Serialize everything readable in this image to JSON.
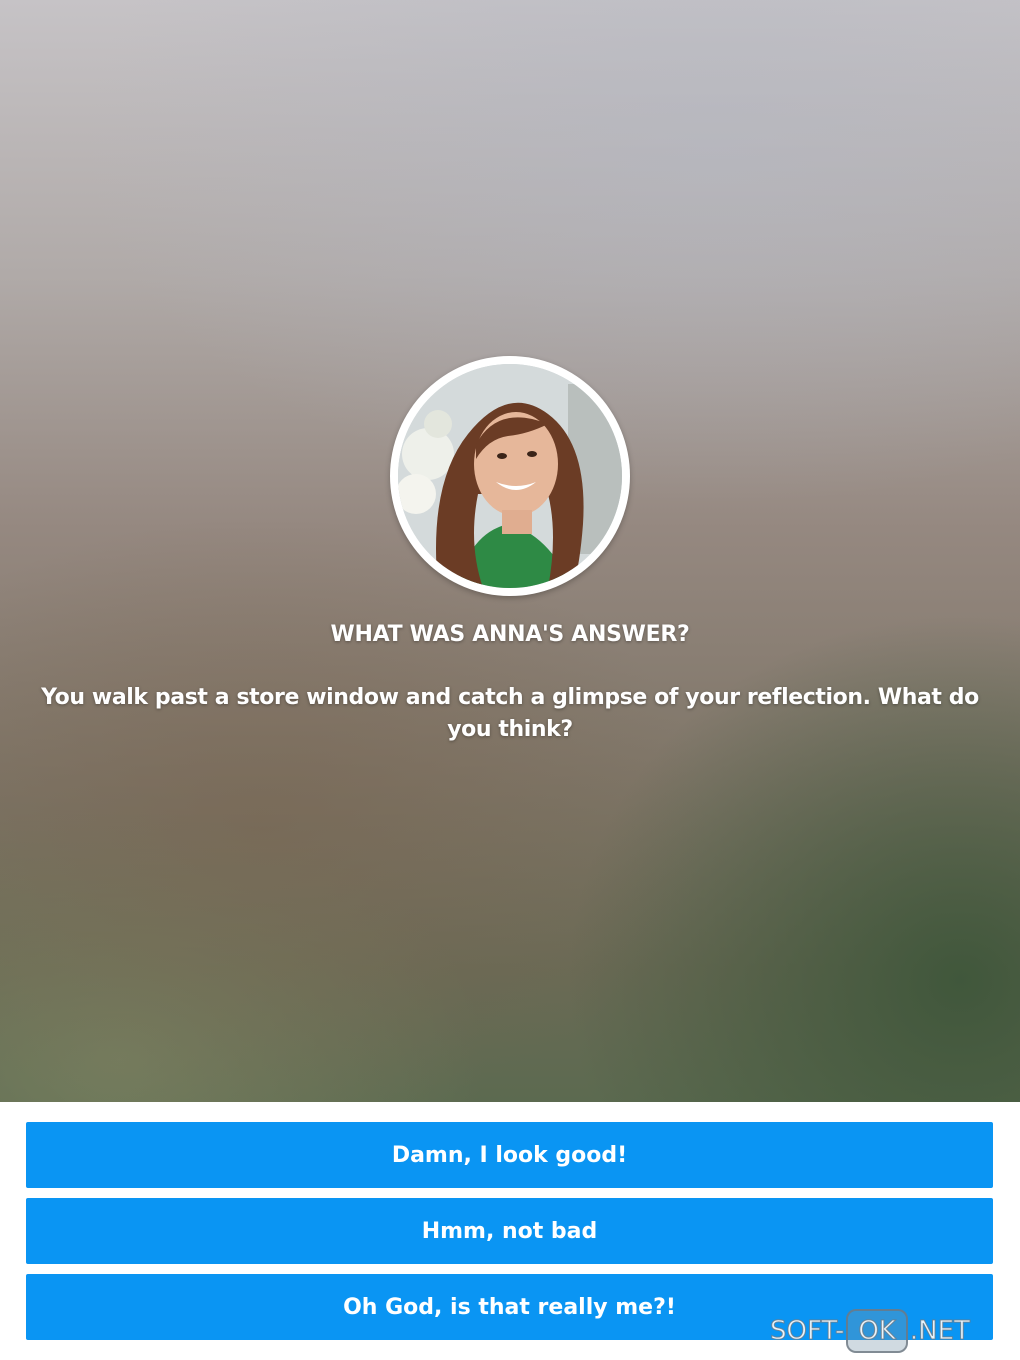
{
  "quiz": {
    "heading": "WHAT WAS ANNA'S ANSWER?",
    "question": "You walk past a store window and catch a glimpse of your reflection. What do you think?",
    "answers": [
      {
        "label": "Damn, I look good!"
      },
      {
        "label": "Hmm, not bad"
      },
      {
        "label": "Oh God, is that really me?!"
      }
    ],
    "accent_color": "#0a95f3"
  },
  "watermark": {
    "left": "SOFT-",
    "middle": "OK",
    "right": ".NET"
  }
}
